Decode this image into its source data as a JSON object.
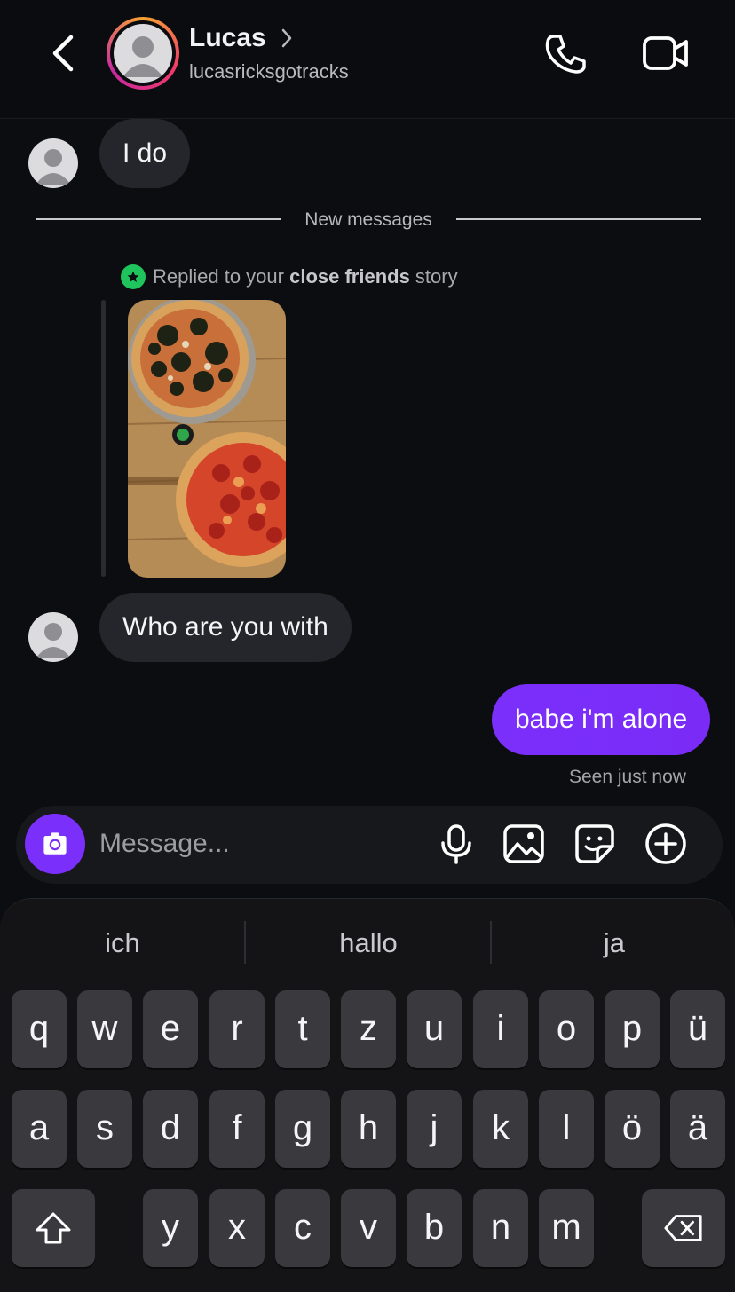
{
  "header": {
    "name": "Lucas",
    "username": "lucasricksgotracks"
  },
  "messages": {
    "first": "I do",
    "divider": "New messages",
    "reply_prefix": "Replied to your ",
    "reply_bold": "close friends",
    "reply_suffix": " story",
    "second": "Who are you with",
    "outgoing": "babe i'm alone",
    "status": "Seen just now"
  },
  "composer": {
    "placeholder": "Message..."
  },
  "keyboard": {
    "suggestions": [
      "ich",
      "hallo",
      "ja"
    ],
    "row1": [
      "q",
      "w",
      "e",
      "r",
      "t",
      "z",
      "u",
      "i",
      "o",
      "p",
      "ü"
    ],
    "row2": [
      "a",
      "s",
      "d",
      "f",
      "g",
      "h",
      "j",
      "k",
      "l",
      "ö",
      "ä"
    ],
    "row3": [
      "y",
      "x",
      "c",
      "v",
      "b",
      "n",
      "m"
    ]
  },
  "colors": {
    "accent": "#7b2ffb",
    "incoming_bubble": "#25262b",
    "background": "#0c0d10",
    "close_friends_green": "#1fc45c"
  },
  "icons": [
    "back-chevron-icon",
    "phone-icon",
    "video-camera-icon",
    "camera-icon",
    "microphone-icon",
    "gallery-icon",
    "sticker-icon",
    "plus-icon",
    "shift-icon",
    "backspace-icon"
  ]
}
